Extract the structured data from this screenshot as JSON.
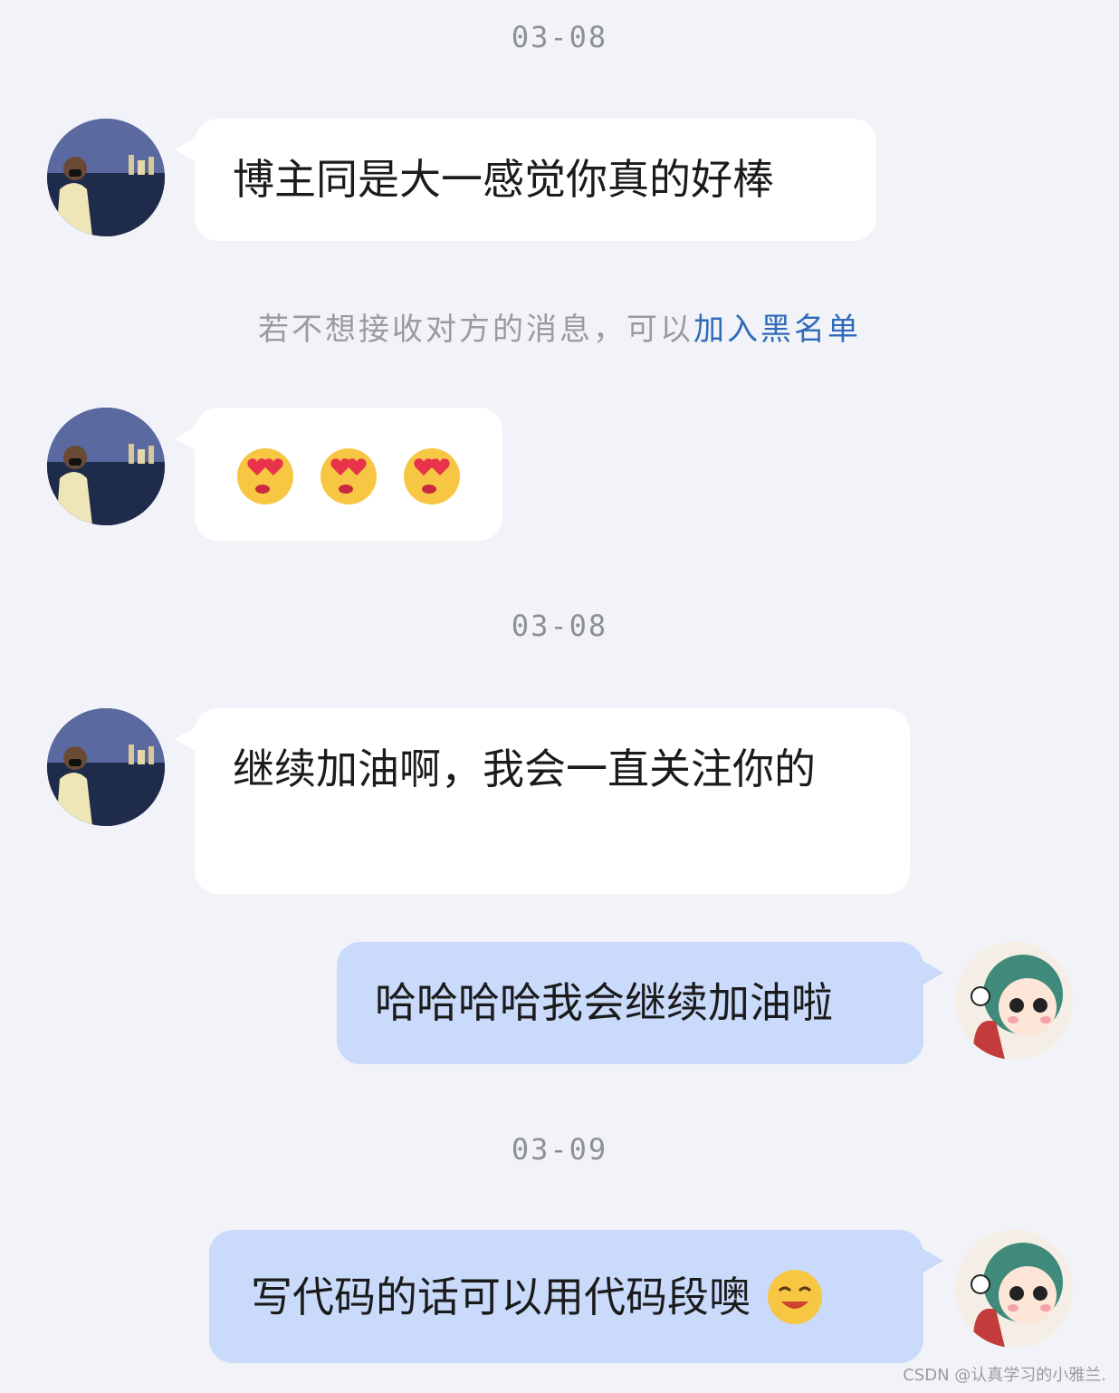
{
  "chat": {
    "dates": [
      "03-08",
      "03-08",
      "03-09"
    ],
    "notice": {
      "text": "若不想接收对方的消息，可以",
      "link": "加入黑名单"
    },
    "messages": [
      {
        "side": "left",
        "text": "博主同是大一感觉你真的好棒"
      },
      {
        "side": "left",
        "emojis": [
          "heart-eyes-kiss-emoji",
          "heart-eyes-kiss-emoji",
          "heart-eyes-kiss-emoji"
        ]
      },
      {
        "side": "left",
        "text": "继续加油啊，我会一直关注你的"
      },
      {
        "side": "right",
        "text": "哈哈哈哈我会继续加油啦"
      },
      {
        "side": "right",
        "text": "写代码的话可以用代码段噢",
        "emoji": "grinning-squint-emoji"
      }
    ]
  },
  "watermark": "CSDN @认真学习的小雅兰.",
  "colors": {
    "background": "#f2f3f8",
    "bubble_left": "#ffffff",
    "bubble_right": "#c9dafb",
    "link": "#2f6bb8",
    "muted_text": "#8e9098"
  }
}
